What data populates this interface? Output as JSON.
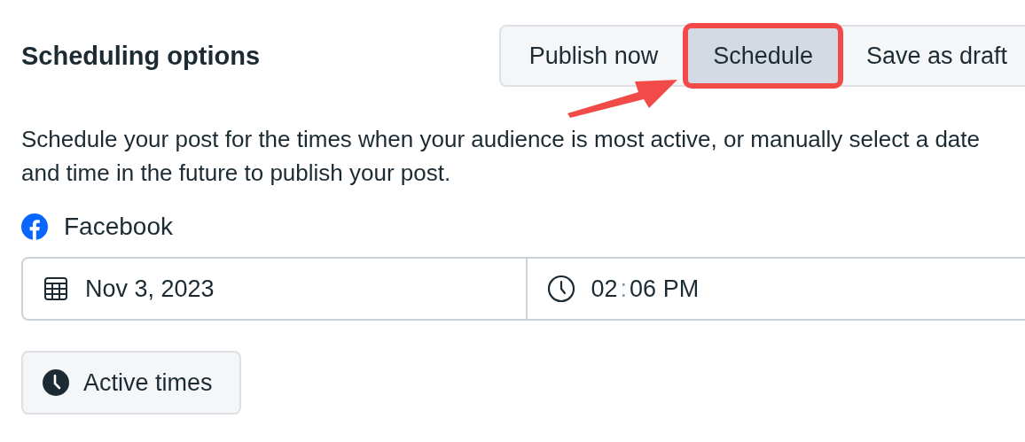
{
  "header": {
    "title": "Scheduling options"
  },
  "publish_modes": [
    {
      "label": "Publish now",
      "selected": false,
      "highlighted": false
    },
    {
      "label": "Schedule",
      "selected": true,
      "highlighted": true
    },
    {
      "label": "Save as draft",
      "selected": false,
      "highlighted": false
    }
  ],
  "description": "Schedule your post for the times when your audience is most active, or manually select a date and time in the future to publish your post.",
  "annotation": {
    "kind": "arrow"
  },
  "platform": {
    "name": "Facebook"
  },
  "date_field": {
    "value": "Nov 3, 2023"
  },
  "time_field": {
    "hour": "02",
    "separator": ":",
    "minute": "06",
    "period": "PM"
  },
  "active_times_button": {
    "label": "Active times"
  }
}
